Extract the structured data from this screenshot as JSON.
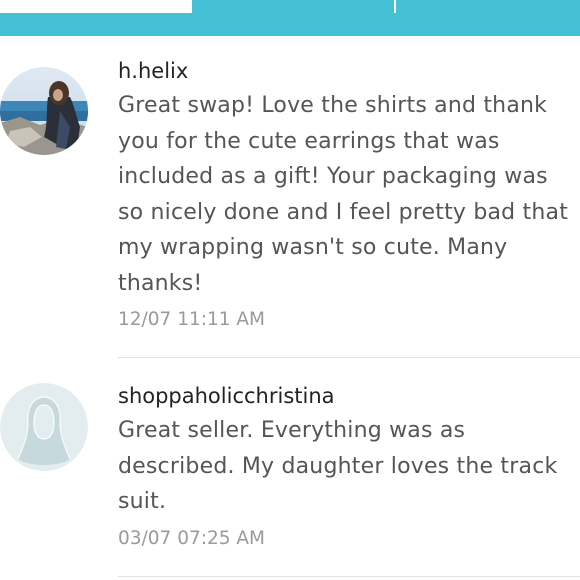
{
  "reviews": [
    {
      "username": "h.helix",
      "text": "Great swap! Love the shirts and thank you for the cute earrings that was included as a gift! Your packaging was so nicely done and I feel pretty bad that my wrapping wasn't so cute. Many thanks!",
      "timestamp": "12/07 11:11 AM",
      "avatar_icon": "user-photo"
    },
    {
      "username": "shoppaholicchristina",
      "text": "Great seller. Everything was as described. My daughter loves the track suit.",
      "timestamp": "03/07 07:25 AM",
      "avatar_icon": "default-avatar-silhouette"
    }
  ],
  "colors": {
    "accent": "#45c1d6",
    "username": "#222222",
    "text": "#555555",
    "timestamp": "#9a9a9a",
    "divider": "#e3e3e3"
  }
}
